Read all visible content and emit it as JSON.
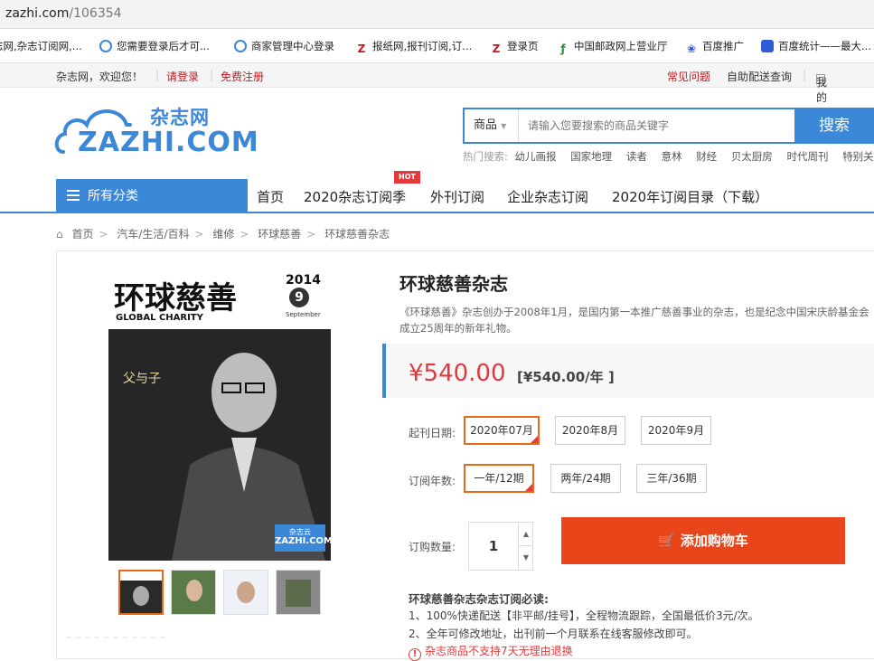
{
  "browser": {
    "url_host": "zazhi.com",
    "url_path": "/106354"
  },
  "bookmarks": [
    {
      "label": "志网,杂志订阅网,...",
      "color": "#3b87d8"
    },
    {
      "label": "您需要登录后才可...",
      "color": "#3b87d8"
    },
    {
      "label": "商家管理中心登录",
      "color": "#3b87d8"
    },
    {
      "label": "报纸网,报刊订阅,订...",
      "color": "#c8161d"
    },
    {
      "label": "登录页",
      "color": "#c8161d"
    },
    {
      "label": "中国邮政网上营业厅",
      "color": "#2e8b3e"
    },
    {
      "label": "百度推广",
      "color": "#2f5bd6"
    },
    {
      "label": "百度统计——最大...",
      "color": "#2f5bd6"
    }
  ],
  "topbar": {
    "welcome": "杂志网，欢迎您！",
    "login": "请登录",
    "register": "免费注册",
    "faq": "常见问题",
    "delivery": "自助配送查询",
    "orders": "我的订单"
  },
  "logo": {
    "cn": "杂志网",
    "en": "ZAZHI.COM"
  },
  "search": {
    "category": "商品",
    "placeholder": "请输入您要搜索的商品关键字",
    "button": "搜索",
    "hot_label": "热门搜索:",
    "hot": [
      "幼儿画报",
      "国家地理",
      "读者",
      "意林",
      "财经",
      "贝太厨房",
      "时代周刊",
      "特别关注"
    ]
  },
  "nav": {
    "all_categories": "所有分类",
    "hot_badge": "HOT",
    "items": [
      "首页",
      "2020杂志订阅季",
      "外刊订阅",
      "企业杂志订阅",
      "2020年订阅目录（下载）"
    ]
  },
  "breadcrumb": [
    "首页",
    "汽车/生活/百科",
    "维修",
    "环球慈善",
    "环球慈善杂志"
  ],
  "product": {
    "cover": {
      "title": "环球慈善",
      "subtitle": "GLOBAL CHARITY",
      "year": "2014",
      "issue": "9",
      "month": "September",
      "headline": "父与子",
      "brand": "杂志云",
      "brand_en": "ZAZHI.COM"
    },
    "name": "环球慈善杂志",
    "description": "《环球慈善》杂志创办于2008年1月，是国内第一本推广慈善事业的杂志，也是纪念中国宋庆龄基金会成立25周年的新年礼物。",
    "price": "¥540.00",
    "price_per_year": "[¥540.00/年 ]",
    "start_label": "起刊日期:",
    "start_options": [
      "2020年07月",
      "2020年8月",
      "2020年9月"
    ],
    "years_label": "订阅年数:",
    "year_options": [
      "一年/12期",
      "两年/24期",
      "三年/36期"
    ],
    "qty_label": "订购数量:",
    "qty": "1",
    "cart_button": "添加购物车",
    "notice_title": "环球慈善杂志杂志订阅必读:",
    "notice_1": "1、100%快递配送【非平邮/挂号】，全程物流跟踪，全国最低价3元/次。",
    "notice_2": "2、全年可修改地址，出刊前一个月联系在线客服修改即可。",
    "notice_3": "杂志商品不支持7天无理由退换"
  },
  "colors": {
    "brand_blue": "#3b87d8",
    "price_red": "#e4393c",
    "cart_orange": "#e8461a",
    "selected_border": "#e86a19"
  }
}
